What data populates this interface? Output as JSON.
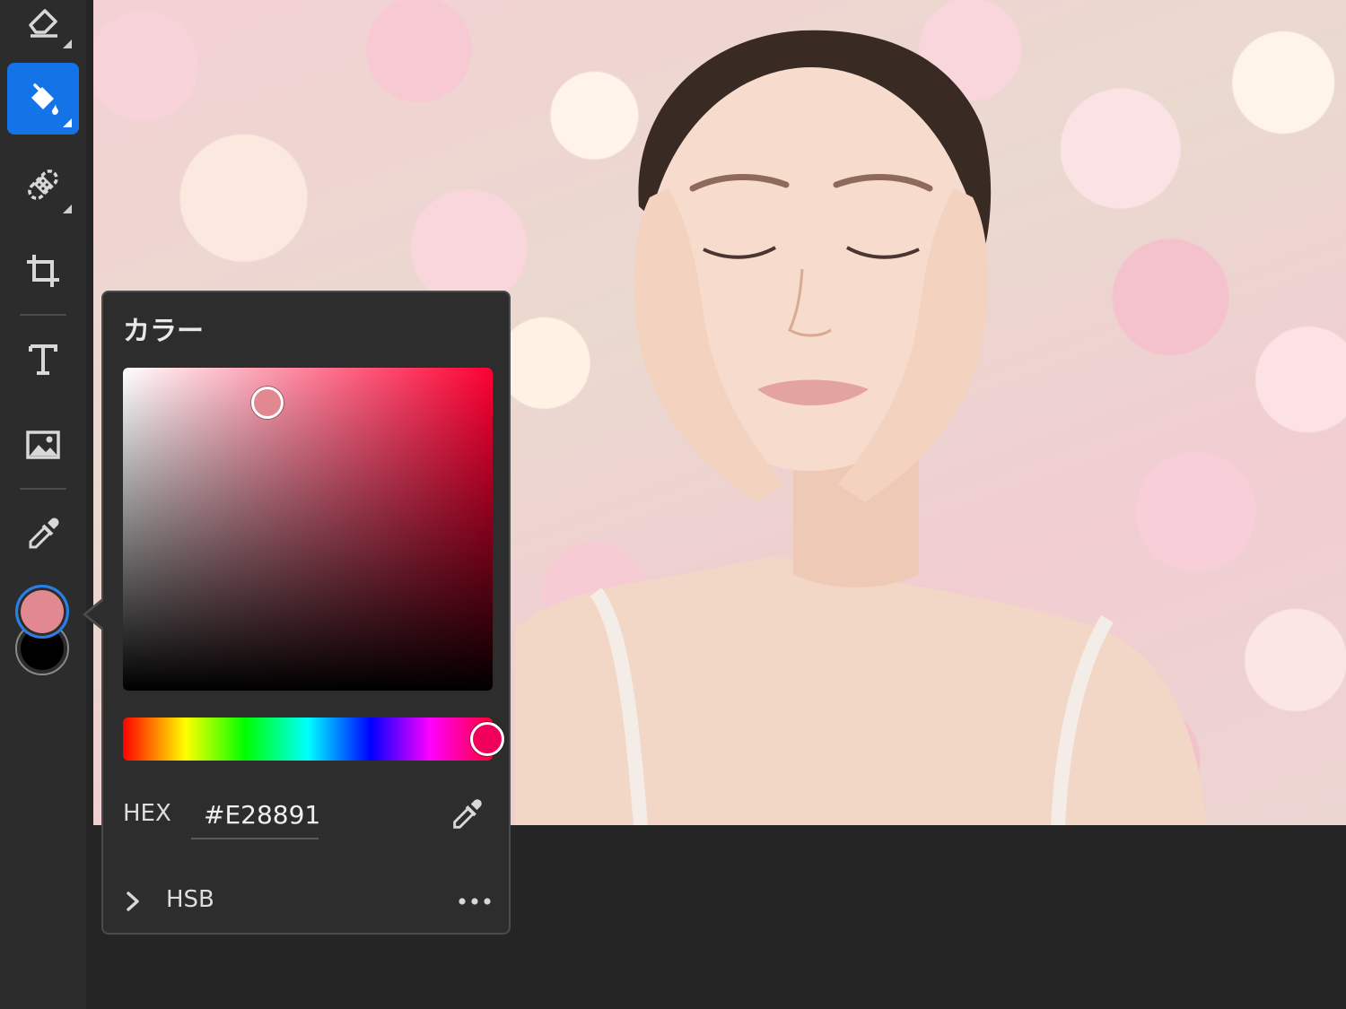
{
  "toolbar": {
    "tools": [
      {
        "name": "eraser-tool",
        "icon": "eraser-icon"
      },
      {
        "name": "paint-bucket-tool",
        "icon": "paint-bucket-icon",
        "active": true
      },
      {
        "name": "healing-tool",
        "icon": "bandage-icon"
      },
      {
        "name": "crop-tool",
        "icon": "crop-icon"
      },
      {
        "name": "text-tool",
        "icon": "text-icon"
      },
      {
        "name": "image-tool",
        "icon": "image-icon"
      },
      {
        "name": "eyedropper-tool",
        "icon": "eyedropper-icon"
      }
    ],
    "foreground_color": "#E28891",
    "background_color": "#000000"
  },
  "color_panel": {
    "title": "カラー",
    "hex_label": "HEX",
    "hex_value": "#E28891",
    "mode_label": "HSB",
    "accent": "#1473e6"
  }
}
